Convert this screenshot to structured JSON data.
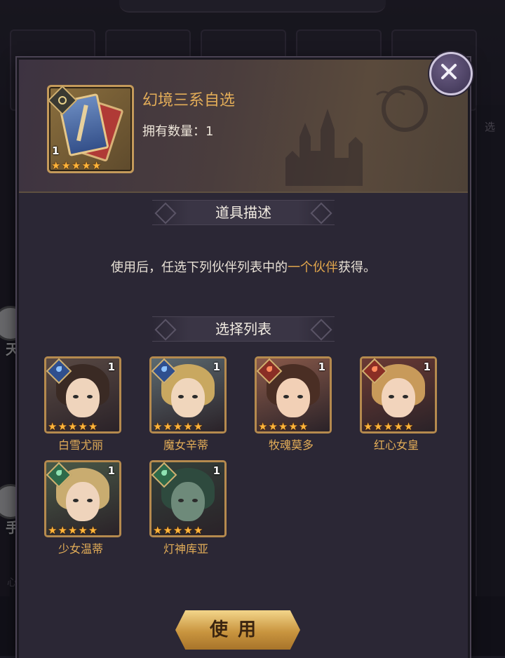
{
  "background": {
    "side_left_labels": [
      "天",
      "手"
    ],
    "side_right_label": "选",
    "bottom_left_label": "心"
  },
  "item": {
    "name": "幻境三系自选",
    "owned_label": "拥有数量：1",
    "count": "1",
    "stars": 5
  },
  "sections": {
    "description_title": "道具描述",
    "list_title": "选择列表"
  },
  "description": {
    "prefix": "使用后，任选下列伙伴列表中的",
    "highlight": "一个伙伴",
    "suffix": "获得。"
  },
  "companions": [
    {
      "name": "白雪尤丽",
      "count": "1",
      "element": "water-icon",
      "stars": 5
    },
    {
      "name": "魔女辛蒂",
      "count": "1",
      "element": "water-icon",
      "stars": 5
    },
    {
      "name": "牧魂莫多",
      "count": "1",
      "element": "fire-icon",
      "stars": 5
    },
    {
      "name": "红心女皇",
      "count": "1",
      "element": "fire-icon",
      "stars": 5
    },
    {
      "name": "少女温蒂",
      "count": "1",
      "element": "wind-icon",
      "stars": 5
    },
    {
      "name": "灯神库亚",
      "count": "1",
      "element": "wind-icon",
      "stars": 5
    }
  ],
  "buttons": {
    "use_label": "使用",
    "close_icon": "close-icon"
  },
  "colors": {
    "accent_gold": "#e3ad58",
    "highlight": "#e0a54c",
    "modal_bg": "#2b2735"
  }
}
